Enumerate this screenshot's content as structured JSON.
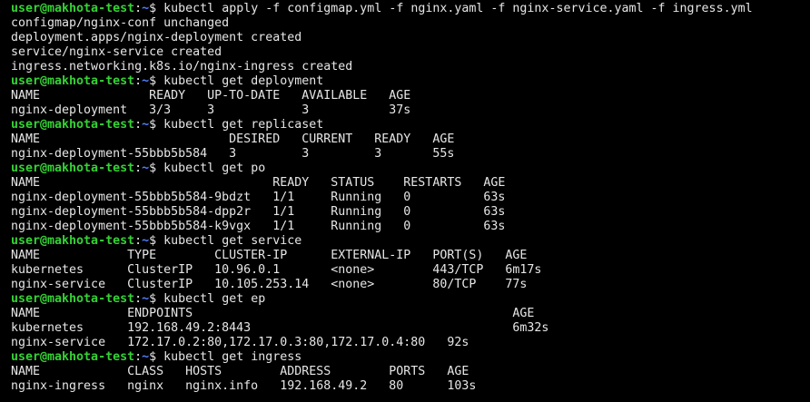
{
  "terminal": {
    "user_host": "user@makhota-test",
    "cwd": "~",
    "prompt_symbol": "$",
    "colors": {
      "background": "#000000",
      "text": "#e6e6e6",
      "prompt_user": "#35d135",
      "prompt_path": "#4f7fff"
    },
    "lines": [
      {
        "type": "prompt",
        "text": "kubectl apply -f configmap.yml -f nginx.yaml -f nginx-service.yaml -f ingress.yml"
      },
      {
        "type": "output",
        "text": "configmap/nginx-conf unchanged"
      },
      {
        "type": "output",
        "text": "deployment.apps/nginx-deployment created"
      },
      {
        "type": "output",
        "text": "service/nginx-service created"
      },
      {
        "type": "output",
        "text": "ingress.networking.k8s.io/nginx-ingress created"
      },
      {
        "type": "prompt",
        "text": "kubectl get deployment"
      },
      {
        "type": "output",
        "text": "NAME               READY   UP-TO-DATE   AVAILABLE   AGE"
      },
      {
        "type": "output",
        "text": "nginx-deployment   3/3     3            3           37s"
      },
      {
        "type": "prompt",
        "text": "kubectl get replicaset"
      },
      {
        "type": "output",
        "text": "NAME                          DESIRED   CURRENT   READY   AGE"
      },
      {
        "type": "output",
        "text": "nginx-deployment-55bbb5b584   3         3         3       55s"
      },
      {
        "type": "prompt",
        "text": "kubectl get po"
      },
      {
        "type": "output",
        "text": "NAME                                READY   STATUS    RESTARTS   AGE"
      },
      {
        "type": "output",
        "text": "nginx-deployment-55bbb5b584-9bdzt   1/1     Running   0          63s"
      },
      {
        "type": "output",
        "text": "nginx-deployment-55bbb5b584-dpp2r   1/1     Running   0          63s"
      },
      {
        "type": "output",
        "text": "nginx-deployment-55bbb5b584-k9vgx   1/1     Running   0          63s"
      },
      {
        "type": "prompt",
        "text": "kubectl get service"
      },
      {
        "type": "output",
        "text": "NAME            TYPE        CLUSTER-IP      EXTERNAL-IP   PORT(S)   AGE"
      },
      {
        "type": "output",
        "text": "kubernetes      ClusterIP   10.96.0.1       <none>        443/TCP   6m17s"
      },
      {
        "type": "output",
        "text": "nginx-service   ClusterIP   10.105.253.14   <none>        80/TCP    77s"
      },
      {
        "type": "prompt",
        "text": "kubectl get ep"
      },
      {
        "type": "output",
        "text": "NAME            ENDPOINTS                                            AGE"
      },
      {
        "type": "output",
        "text": "kubernetes      192.168.49.2:8443                                    6m32s"
      },
      {
        "type": "output",
        "text": "nginx-service   172.17.0.2:80,172.17.0.3:80,172.17.0.4:80   92s"
      },
      {
        "type": "prompt",
        "text": "kubectl get ingress"
      },
      {
        "type": "output",
        "text": "NAME            CLASS   HOSTS        ADDRESS        PORTS   AGE"
      },
      {
        "type": "output",
        "text": "nginx-ingress   nginx   nginx.info   192.168.49.2   80      103s"
      }
    ]
  }
}
